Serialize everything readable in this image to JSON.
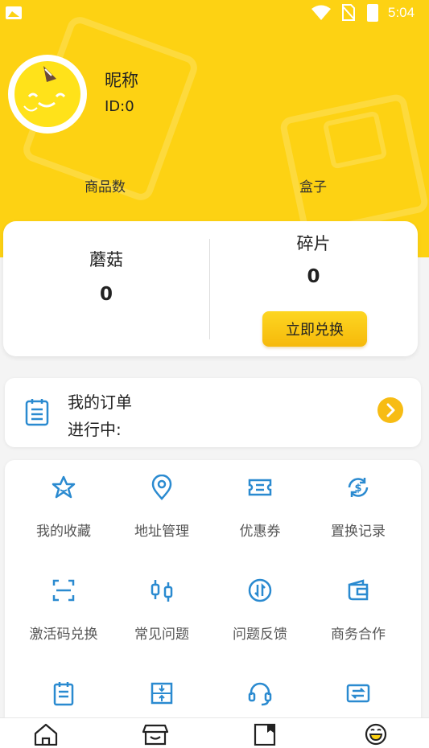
{
  "status_bar": {
    "time": "5:04"
  },
  "profile": {
    "nickname": "昵称",
    "id_text": "ID:0"
  },
  "stats": {
    "goods_label": "商品数",
    "box_label": "盒子"
  },
  "wallet": {
    "mushroom_label": "蘑菇",
    "mushroom_value": "0",
    "fragment_label": "碎片",
    "fragment_value": "0",
    "exchange_button": "立即兑换"
  },
  "orders": {
    "title": "我的订单",
    "status": "进行中:"
  },
  "services": [
    {
      "label": "我的收藏",
      "icon": "star-icon"
    },
    {
      "label": "地址管理",
      "icon": "location-pin-icon"
    },
    {
      "label": "优惠券",
      "icon": "ticket-icon"
    },
    {
      "label": "置换记录",
      "icon": "currency-cycle-icon"
    },
    {
      "label": "激活码兑换",
      "icon": "scan-icon"
    },
    {
      "label": "常见问题",
      "icon": "faq-icon"
    },
    {
      "label": "问题反馈",
      "icon": "feedback-icon"
    },
    {
      "label": "商务合作",
      "icon": "wallet-icon"
    },
    {
      "label": "",
      "icon": "notes-icon"
    },
    {
      "label": "",
      "icon": "expand-icon"
    },
    {
      "label": "",
      "icon": "headset-icon"
    },
    {
      "label": "",
      "icon": "swap-icon"
    }
  ],
  "tabs": [
    {
      "icon": "home-icon"
    },
    {
      "icon": "store-icon"
    },
    {
      "icon": "box-icon"
    },
    {
      "icon": "smiley-icon"
    }
  ],
  "colors": {
    "brand_yellow": "#fdd213",
    "accent_blue": "#2a8ad0",
    "button_orange": "#f6b90a"
  }
}
